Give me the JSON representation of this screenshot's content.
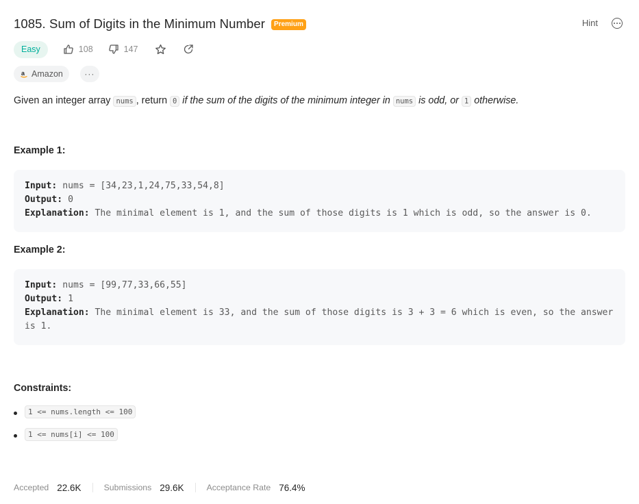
{
  "problem": {
    "title": "1085. Sum of Digits in the Minimum Number",
    "premium_label": "Premium",
    "hint_label": "Hint",
    "difficulty": "Easy",
    "likes": "108",
    "dislikes": "147",
    "company": "Amazon",
    "company_more": "···"
  },
  "description": {
    "part1": "Given an integer array ",
    "code1": "nums",
    "part2": ", return ",
    "code2": "0",
    "part3": " if the sum of the digits of the minimum integer in ",
    "code3": "nums",
    "part4": " is odd, or ",
    "code4": "1",
    "part5": " otherwise."
  },
  "examples": [
    {
      "title": "Example 1:",
      "input_label": "Input:",
      "input": " nums = [34,23,1,24,75,33,54,8]",
      "output_label": "Output:",
      "output": " 0",
      "explanation_label": "Explanation:",
      "explanation": " The minimal element is 1, and the sum of those digits is 1 which is odd, so the answer is 0."
    },
    {
      "title": "Example 2:",
      "input_label": "Input:",
      "input": " nums = [99,77,33,66,55]",
      "output_label": "Output:",
      "output": " 1",
      "explanation_label": "Explanation:",
      "explanation": " The minimal element is 33, and the sum of those digits is 3 + 3 = 6 which is even, so the answer is 1."
    }
  ],
  "constraints": {
    "title": "Constraints:",
    "items": [
      "1 <= nums.length <= 100",
      "1 <= nums[i] <= 100"
    ]
  },
  "stats": {
    "accepted_label": "Accepted",
    "accepted": "22.6K",
    "submissions_label": "Submissions",
    "submissions": "29.6K",
    "rate_label": "Acceptance Rate",
    "rate": "76.4%"
  },
  "colors": {
    "easy": "#00af9b",
    "premium": "#ffa116",
    "text": "#262626",
    "muted": "#8c8c8c"
  }
}
